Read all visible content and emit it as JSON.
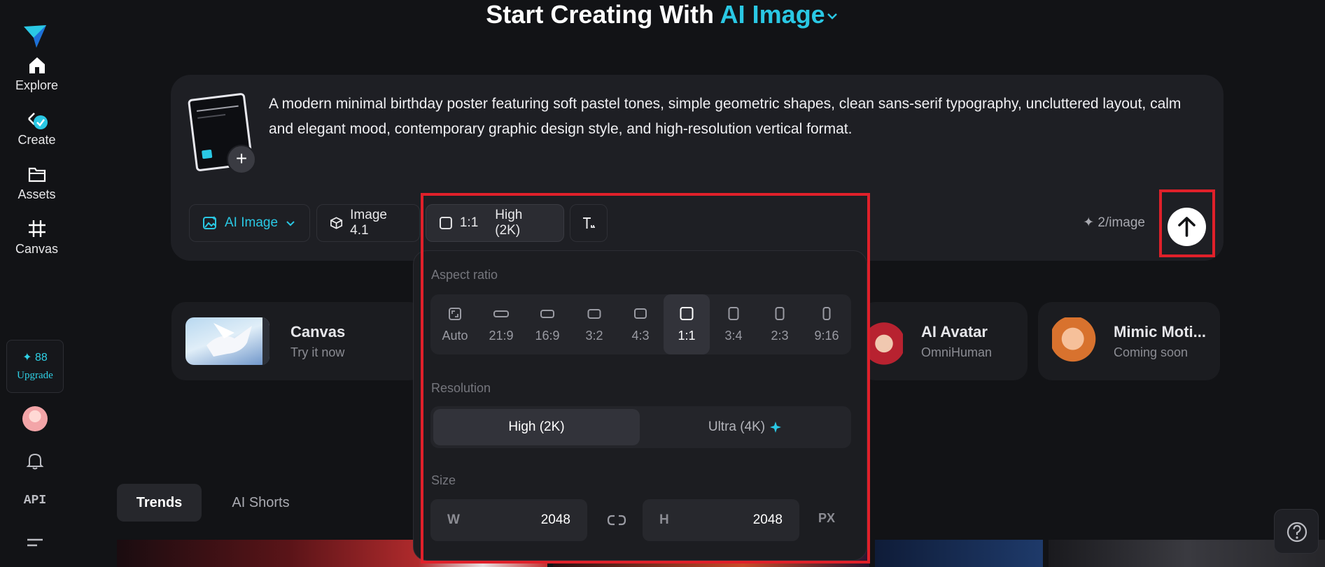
{
  "header": {
    "title_prefix": "Start Creating With",
    "title_accent": "AI Image"
  },
  "sidebar": {
    "items": [
      {
        "label": "Explore",
        "icon": "home-icon"
      },
      {
        "label": "Create",
        "icon": "create-icon"
      },
      {
        "label": "Assets",
        "icon": "folder-icon"
      },
      {
        "label": "Canvas",
        "icon": "canvas-icon"
      }
    ],
    "credits": "88",
    "upgrade_label": "Upgrade",
    "api_label": "API"
  },
  "prompt": {
    "text": "A modern minimal birthday poster featuring soft pastel tones, simple geometric shapes, clean sans-serif typography, uncluttered layout, calm and elegant mood, contemporary graphic design style, and high-resolution vertical format.",
    "mode_label": "AI Image",
    "model_label": "Image 4.1",
    "ratio_label": "1:1",
    "quality_label": "High (2K)",
    "cost_label": "2/image"
  },
  "features": [
    {
      "title": "Canvas",
      "subtitle": "Try it now"
    },
    {
      "title": "AI Avatar",
      "subtitle": "OmniHuman"
    },
    {
      "title": "Mimic Moti...",
      "subtitle": "Coming soon"
    }
  ],
  "tabs": [
    {
      "label": "Trends",
      "active": true
    },
    {
      "label": "AI Shorts",
      "active": false
    }
  ],
  "panel": {
    "aspect_label": "Aspect ratio",
    "ratios": [
      "Auto",
      "21:9",
      "16:9",
      "3:2",
      "4:3",
      "1:1",
      "3:4",
      "2:3",
      "9:16"
    ],
    "selected_ratio": "1:1",
    "resolution_label": "Resolution",
    "resolutions": [
      "High (2K)",
      "Ultra (4K)"
    ],
    "size_label": "Size",
    "width_key": "W",
    "width_value": "2048",
    "height_key": "H",
    "height_value": "2048",
    "unit": "PX"
  },
  "colors": {
    "accent": "#2ac8e4",
    "highlight": "#e0202a",
    "background": "#121316"
  }
}
